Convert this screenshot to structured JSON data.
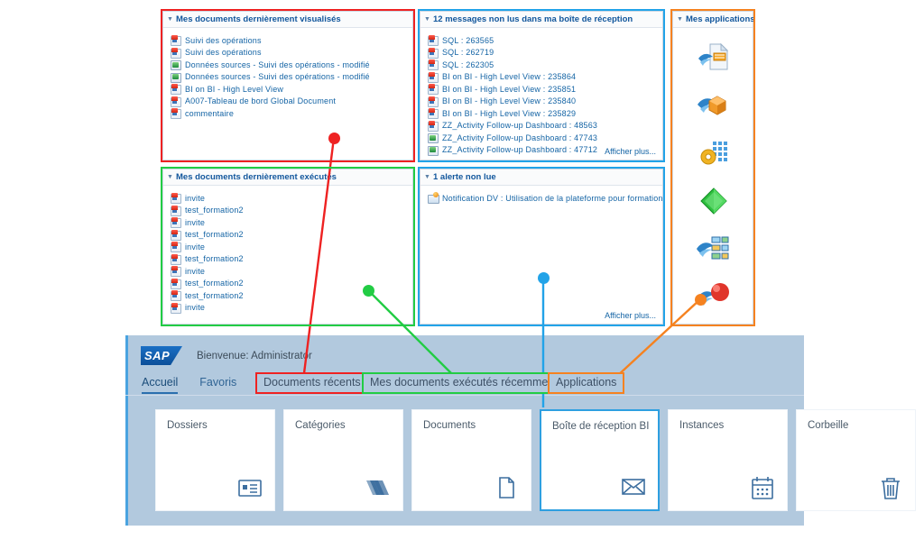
{
  "colors": {
    "red": "#ee2222",
    "green": "#22cc44",
    "blue": "#22a3e8",
    "orange": "#f58220",
    "panel_title": "#11569c",
    "link": "#1464a5",
    "launchpad_bg": "#b2c9de",
    "tile_selected": "#2e9fe0"
  },
  "panels": {
    "recent_viewed": {
      "title": "Mes documents dernièrement visualisés",
      "items": [
        {
          "icon": "webi-document-icon",
          "label": "Suivi des opérations"
        },
        {
          "icon": "webi-document-icon",
          "label": "Suivi des opérations"
        },
        {
          "icon": "excel-document-icon",
          "label": "Données sources - Suivi des opérations - modifié"
        },
        {
          "icon": "excel-document-icon",
          "label": "Données sources - Suivi des opérations - modifié"
        },
        {
          "icon": "webi-document-icon",
          "label": "BI on BI - High Level View"
        },
        {
          "icon": "webi-document-icon",
          "label": "A007-Tableau de bord Global Document"
        },
        {
          "icon": "webi-document-icon",
          "label": "commentaire"
        }
      ]
    },
    "recent_run": {
      "title": "Mes documents dernièrement exécutés",
      "items": [
        {
          "icon": "webi-document-icon",
          "label": "invite"
        },
        {
          "icon": "webi-document-icon",
          "label": "test_formation2"
        },
        {
          "icon": "webi-document-icon",
          "label": "invite"
        },
        {
          "icon": "webi-document-icon",
          "label": "test_formation2"
        },
        {
          "icon": "webi-document-icon",
          "label": "invite"
        },
        {
          "icon": "webi-document-icon",
          "label": "test_formation2"
        },
        {
          "icon": "webi-document-icon",
          "label": "invite"
        },
        {
          "icon": "webi-document-icon",
          "label": "test_formation2"
        },
        {
          "icon": "webi-document-icon",
          "label": "test_formation2"
        },
        {
          "icon": "webi-document-icon",
          "label": "invite"
        }
      ]
    },
    "inbox": {
      "title": "12 messages non lus dans ma boîte de réception",
      "show_more": "Afficher plus...",
      "items": [
        {
          "icon": "webi-document-icon",
          "label": "SQL : 263565"
        },
        {
          "icon": "webi-document-icon",
          "label": "SQL : 262719"
        },
        {
          "icon": "webi-document-icon",
          "label": "SQL : 262305"
        },
        {
          "icon": "webi-document-icon",
          "label": "BI on BI - High Level View : 235864"
        },
        {
          "icon": "webi-document-icon",
          "label": "BI on BI - High Level View : 235851"
        },
        {
          "icon": "webi-document-icon",
          "label": "BI on BI - High Level View : 235840"
        },
        {
          "icon": "webi-document-icon",
          "label": "BI on BI - High Level View : 235829"
        },
        {
          "icon": "webi-document-icon",
          "label": "ZZ_Activity Follow-up Dashboard : 48563"
        },
        {
          "icon": "excel-document-icon",
          "label": "ZZ_Activity Follow-up Dashboard : 47743"
        },
        {
          "icon": "excel-document-icon",
          "label": "ZZ_Activity Follow-up Dashboard : 47712"
        }
      ]
    },
    "alerts": {
      "title": "1 alerte non lue",
      "show_more": "Afficher plus...",
      "items": [
        {
          "icon": "alert-envelope-icon",
          "label": "Notification DV : Utilisation de la plateforme pour formation"
        }
      ]
    },
    "applications": {
      "title": "Mes applications",
      "items": [
        {
          "icon": "webi-report-app-icon",
          "name": "web-intelligence"
        },
        {
          "icon": "cube-app-icon",
          "name": "analysis-olap"
        },
        {
          "icon": "gear-grid-app-icon",
          "name": "bi-administration"
        },
        {
          "icon": "green-diamond-app-icon",
          "name": "explorer"
        },
        {
          "icon": "dashboard-tiles-app-icon",
          "name": "dashboards"
        },
        {
          "icon": "red-sphere-app-icon",
          "name": "crystal-reports"
        }
      ]
    }
  },
  "launchpad": {
    "logo_text": "SAP",
    "welcome": "Bienvenue: Administrator",
    "tabs": [
      {
        "label": "Accueil",
        "active": true
      },
      {
        "label": "Favoris",
        "active": false
      },
      {
        "label": "Documents récents",
        "active": false
      },
      {
        "label": "Mes documents exécutés récemment",
        "active": false
      },
      {
        "label": "Applications",
        "active": false
      }
    ],
    "tiles": [
      {
        "label": "Dossiers",
        "icon": "folder-card-icon",
        "selected": false
      },
      {
        "label": "Catégories",
        "icon": "layers-icon",
        "selected": false
      },
      {
        "label": "Documents",
        "icon": "document-page-icon",
        "selected": false
      },
      {
        "label": "Boîte de réception BI",
        "icon": "envelope-icon",
        "selected": true
      },
      {
        "label": "Instances",
        "icon": "calendar-icon",
        "selected": false
      },
      {
        "label": "Corbeille",
        "icon": "trash-icon",
        "selected": false
      }
    ]
  },
  "annotations": [
    {
      "id": "red",
      "label": "Documents récents",
      "color": "#ee2222"
    },
    {
      "id": "green",
      "label": "Mes documents exécutés récemment",
      "color": "#22cc44"
    },
    {
      "id": "blue",
      "label": "",
      "color": "#22a3e8"
    },
    {
      "id": "orange",
      "label": "Applications",
      "color": "#f58220"
    }
  ]
}
